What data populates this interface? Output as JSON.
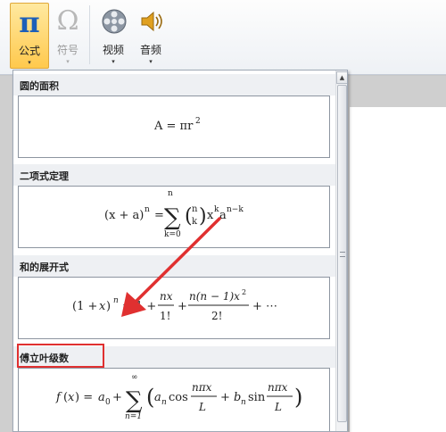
{
  "ribbon": {
    "formula": {
      "label": "公式",
      "glyph": "π"
    },
    "symbol": {
      "label": "符号",
      "glyph": "Ω"
    },
    "video": {
      "label": "视频"
    },
    "audio": {
      "label": "音频"
    },
    "arrow": "▾"
  },
  "gallery": {
    "sections": [
      {
        "title": "圆的面积"
      },
      {
        "title": "二项式定理"
      },
      {
        "title": "和的展开式"
      },
      {
        "title": "傅立叶级数"
      }
    ]
  },
  "colors": {
    "accent": "#ffc94d",
    "highlight": "#e03030",
    "arrow": "#e03030"
  },
  "icons": [
    "pi-icon",
    "omega-icon",
    "film-reel-icon",
    "speaker-icon"
  ]
}
